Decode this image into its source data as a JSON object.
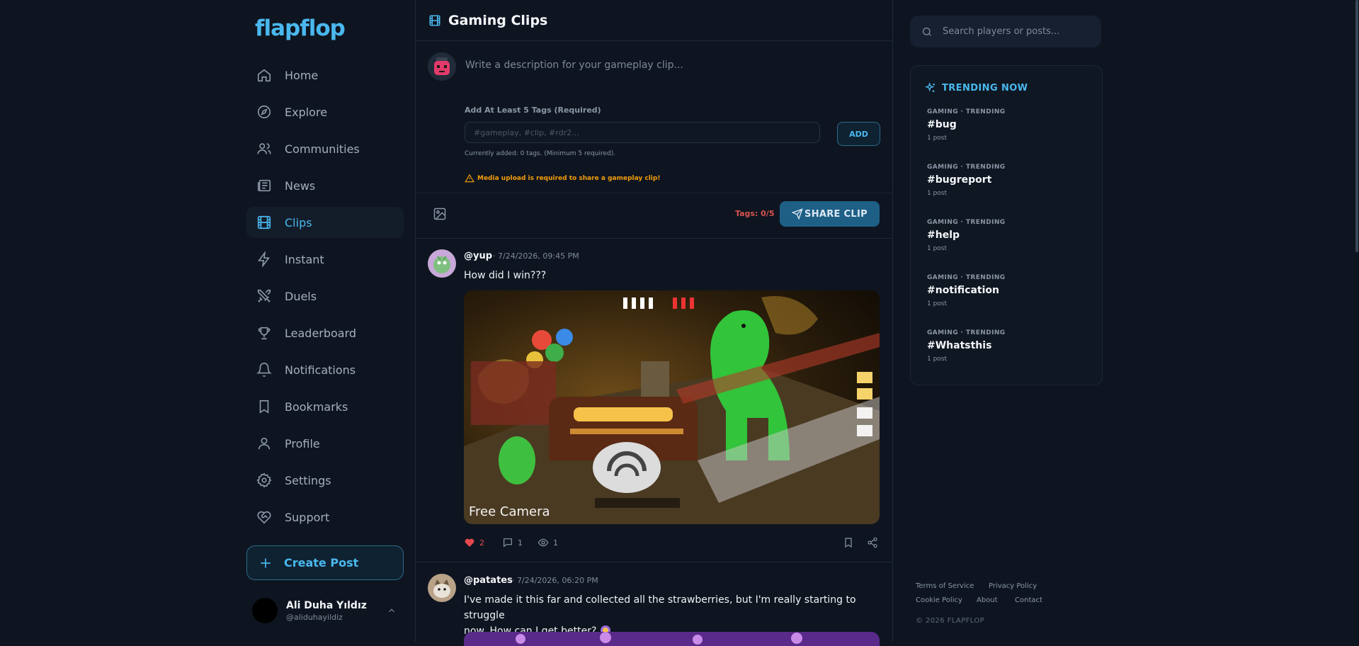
{
  "brand": {
    "logo": "flapflop"
  },
  "nav": {
    "items": [
      {
        "label": "Home",
        "icon": "home-icon"
      },
      {
        "label": "Explore",
        "icon": "compass-icon"
      },
      {
        "label": "Communities",
        "icon": "users-icon"
      },
      {
        "label": "News",
        "icon": "newspaper-icon"
      },
      {
        "label": "Clips",
        "icon": "film-icon",
        "active": true
      },
      {
        "label": "Instant",
        "icon": "zap-icon"
      },
      {
        "label": "Duels",
        "icon": "swords-icon"
      },
      {
        "label": "Leaderboard",
        "icon": "trophy-icon"
      },
      {
        "label": "Notifications",
        "icon": "bell-icon"
      },
      {
        "label": "Bookmarks",
        "icon": "bookmark-icon"
      },
      {
        "label": "Profile",
        "icon": "user-icon"
      },
      {
        "label": "Settings",
        "icon": "gear-icon"
      },
      {
        "label": "Support",
        "icon": "heart-handshake-icon"
      }
    ],
    "create_post": "Create Post"
  },
  "user": {
    "name": "Ali Duha Yıldız",
    "handle": "@aliduhayildiz"
  },
  "page": {
    "title": "Gaming Clips"
  },
  "composer": {
    "description_placeholder": "Write a description for your gameplay clip...",
    "tags_label": "Add At Least 5 Tags (Required)",
    "tags_placeholder": "#gameplay, #clip, #rdr2...",
    "add_label": "ADD",
    "tags_status": "Currently added: 0 tags. (Minimum 5 required).",
    "media_warning": "Media upload is required to share a gameplay clip!",
    "tags_counter": "Tags: 0/5",
    "share_label": "SHARE CLIP"
  },
  "posts": [
    {
      "user": "@yup",
      "time": "· 7/24/2026, 09:45 PM",
      "text": "How did I win???",
      "media_caption": "Free Camera",
      "likes": "2",
      "comments": "1",
      "views": "1"
    },
    {
      "user": "@patates",
      "time": "· 7/24/2026, 06:20 PM",
      "text_line1": "I've made it this far and collected all the strawberries, but I'm really starting to struggle",
      "text_line2": "now. How can I get better?"
    }
  ],
  "search": {
    "placeholder": "Search players or posts..."
  },
  "trending": {
    "title": "TRENDING NOW",
    "items": [
      {
        "category": "GAMING · TRENDING",
        "tag": "#bug",
        "count": "1 post"
      },
      {
        "category": "GAMING · TRENDING",
        "tag": "#bugreport",
        "count": "1 post"
      },
      {
        "category": "GAMING · TRENDING",
        "tag": "#help",
        "count": "1 post"
      },
      {
        "category": "GAMING · TRENDING",
        "tag": "#notification",
        "count": "1 post"
      },
      {
        "category": "GAMING · TRENDING",
        "tag": "#Whatsthis",
        "count": "1 post"
      }
    ]
  },
  "footer": {
    "terms": "Terms of Service",
    "privacy": "Privacy Policy",
    "cookie": "Cookie Policy",
    "about": "About",
    "contact": "Contact",
    "copyright": "© 2026 FLAPFLOP"
  },
  "colors": {
    "accent": "#4ab8ee",
    "warning": "#f59e0b",
    "danger": "#d9534f",
    "like": "#e5484d"
  }
}
